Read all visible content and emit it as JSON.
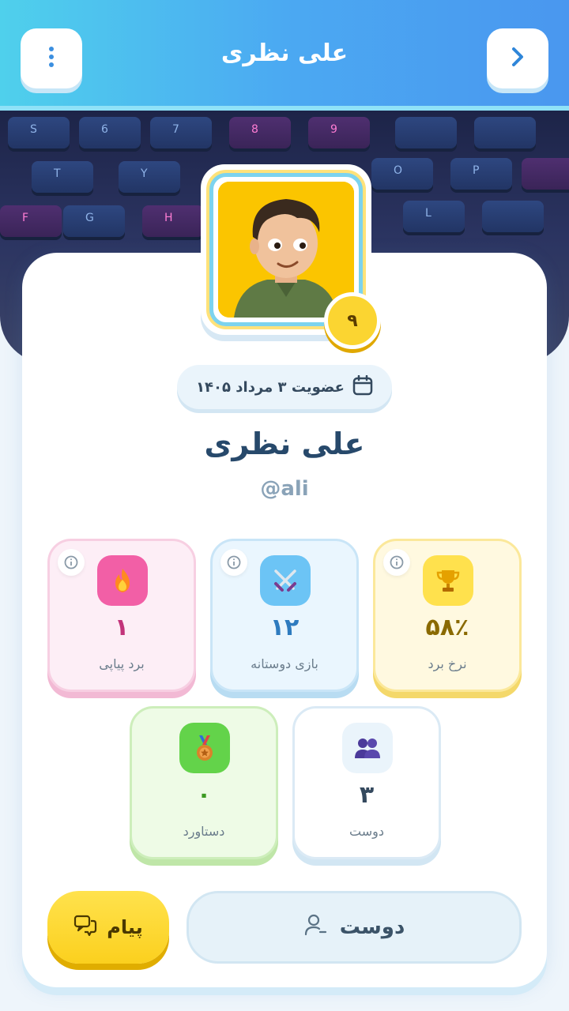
{
  "header": {
    "title": "علی نظری",
    "back_icon": "chevron-right-icon",
    "menu_icon": "more-vertical-icon"
  },
  "profile": {
    "level": "۹",
    "member_since": "عضویت ۳ مرداد ۱۴۰۵",
    "name": "علی نظری",
    "handle": "@ali"
  },
  "stats": [
    {
      "id": "win-rate",
      "value": "۵۸٪",
      "label": "نرخ برد",
      "icon": "trophy-icon",
      "color": "#8a6a00"
    },
    {
      "id": "friendly-games",
      "value": "۱۲",
      "label": "بازی دوستانه",
      "icon": "crossed-swords-icon",
      "color": "#2e7bbf"
    },
    {
      "id": "win-streak",
      "value": "۱",
      "label": "برد پیاپی",
      "icon": "fire-icon",
      "color": "#c2337a"
    },
    {
      "id": "friends",
      "value": "۳",
      "label": "دوست",
      "icon": "people-icon",
      "color": "#34495e"
    },
    {
      "id": "achievements",
      "value": "۰",
      "label": "دستاورد",
      "icon": "medal-icon",
      "color": "#3c9a22"
    }
  ],
  "actions": {
    "friend_label": "دوست",
    "message_label": "پیام"
  },
  "keyboard_keys": [
    "S",
    "6",
    "7",
    "8",
    "9",
    "T",
    "Y",
    "O",
    "P",
    "F",
    "G",
    "H",
    "L"
  ]
}
